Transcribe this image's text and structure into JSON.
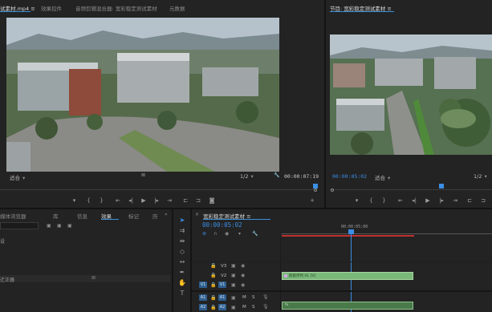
{
  "source_tabs": {
    "source": "试素材.mp4 ≡",
    "effect_controls": "效果控件",
    "audio_mixer": "音频剪辑混合器: 宽彩稳定测试素材",
    "metadata": "元数据"
  },
  "program_tab": "节目: 宽彩稳定测试素材 ≡",
  "source_monitor": {
    "zoom": "适合",
    "resolution": "1/2",
    "timecode": "00:00:07:19"
  },
  "program_monitor": {
    "timecode": "00:00:05:02",
    "zoom": "适合",
    "resolution": "1/2"
  },
  "project_tabs": {
    "media_browser": "媒体浏览器",
    "library": "库",
    "info": "信息",
    "effects": "效果",
    "markers": "标记",
    "history": "历"
  },
  "project_rows": {
    "row1": "设",
    "row2": "迁正器"
  },
  "timeline": {
    "tab": "宽彩稳定测试素材 ≡",
    "timecode": "00:00:05:02",
    "ruler_mark": "00:00:05:00",
    "tracks": {
      "v3": "V3",
      "v2": "V2",
      "v1": "V1",
      "a1": "A1",
      "a2": "A2",
      "v1_target": "V1",
      "a1_target": "A1",
      "a2_target": "A2",
      "m": "M",
      "s": "S"
    },
    "video_clip_label": "嵌套序列 01 [V]",
    "audio_clip_label": "fx"
  },
  "colors": {
    "accent": "#3b8ee5",
    "video_clip": "#7ab87a",
    "audio_clip": "#4a7a4a",
    "work_area": "#c03030",
    "panel_bg": "#232323"
  }
}
